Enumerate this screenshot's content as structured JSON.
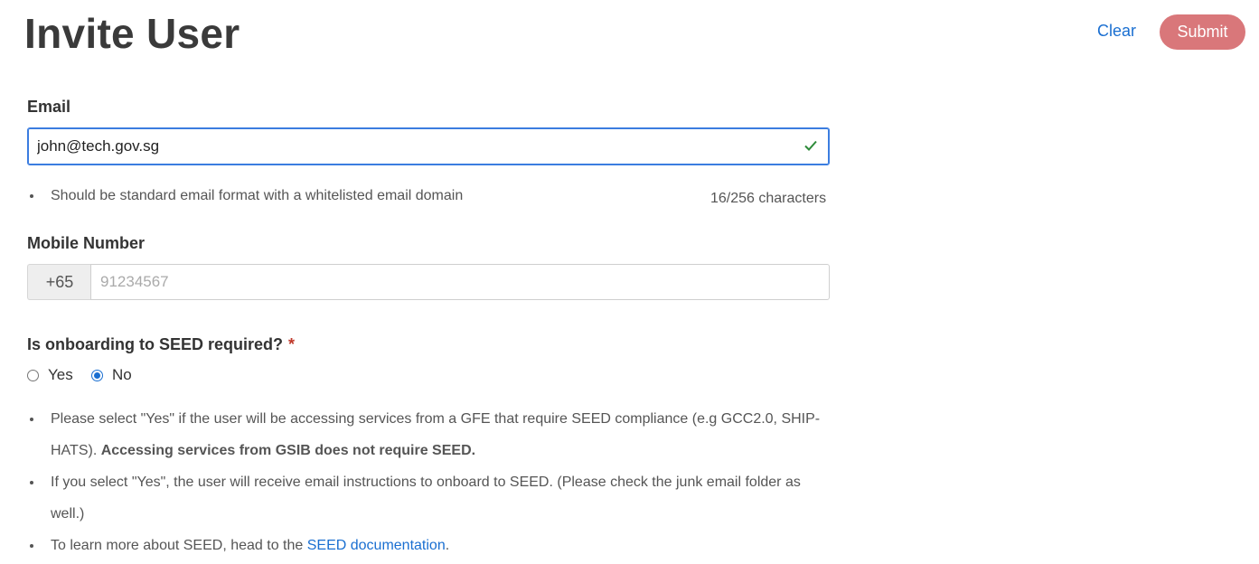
{
  "header": {
    "title": "Invite User",
    "clear_label": "Clear",
    "submit_label": "Submit"
  },
  "email": {
    "label": "Email",
    "value": "john@tech.gov.sg",
    "hint": "Should be standard email format with a whitelisted email domain",
    "char_count": "16/256 characters",
    "valid_icon": "check-icon"
  },
  "mobile": {
    "label": "Mobile Number",
    "prefix": "+65",
    "placeholder": "91234567"
  },
  "seed": {
    "question": "Is onboarding to SEED required?",
    "required_marker": "*",
    "options": [
      {
        "label": "Yes",
        "selected": false
      },
      {
        "label": "No",
        "selected": true
      }
    ],
    "notes": {
      "note1_text": "Please select \"Yes\" if the user will be accessing services from a GFE that require SEED compliance (e.g GCC2.0, SHIP-HATS). ",
      "note1_bold": "Accessing services from GSIB does not require SEED.",
      "note2_text": "If you select \"Yes\", the user will receive email instructions to onboard to SEED. (Please check the junk email folder as well.)",
      "note3_text": "To learn more about SEED, head to the ",
      "note3_link": "SEED documentation",
      "note3_end": "."
    }
  },
  "colors": {
    "accent": "#1a6fd1",
    "submit_bg": "#d9777a",
    "valid": "#2e8b3a",
    "required": "#c0392b"
  }
}
